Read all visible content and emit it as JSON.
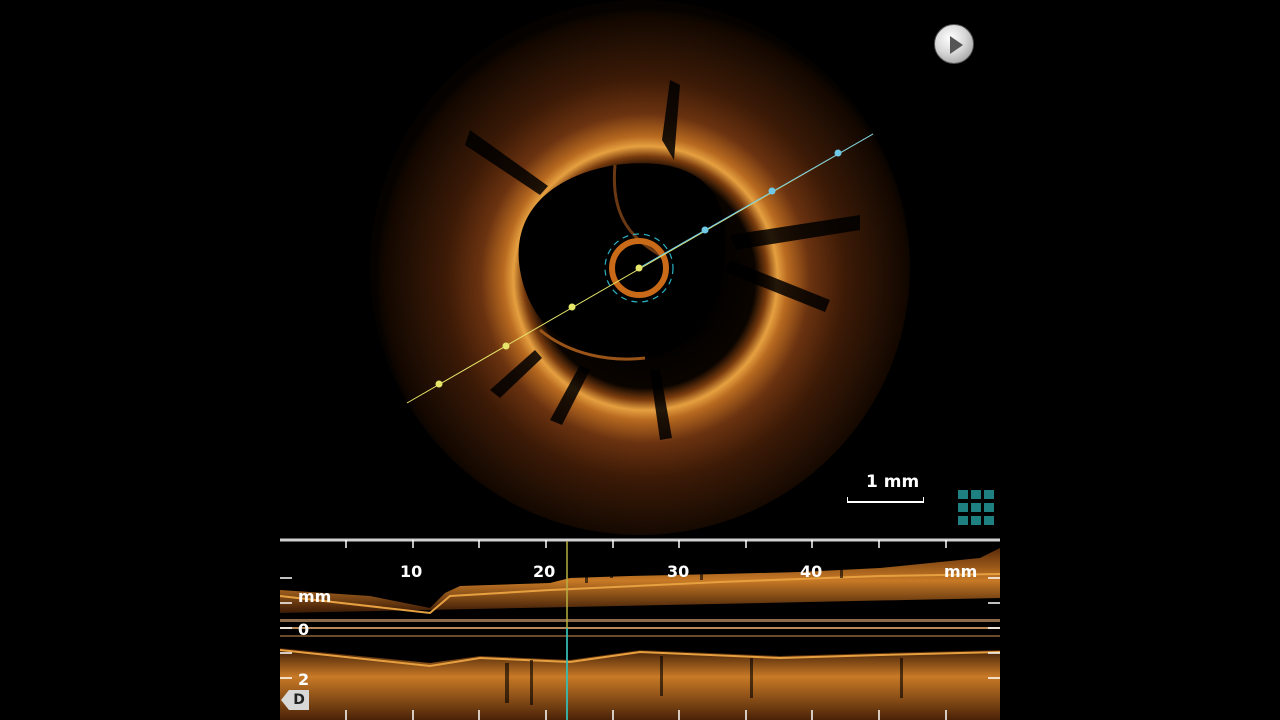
{
  "cross_section": {
    "scale_label": "1 mm"
  },
  "longitudinal": {
    "axis_unit": "mm",
    "top_ticks": [
      "10",
      "20",
      "30",
      "40"
    ],
    "depth_unit": "mm",
    "depth_ticks": [
      "0",
      "2"
    ],
    "frame_marker_position_mm": 21.5,
    "direction_badge": "D"
  },
  "controls": {
    "play_icon": "play-icon",
    "grid_icon": "layout-grid-icon"
  },
  "colors": {
    "tissue": "#e08a2a",
    "measure_proximal": "#e6e66a",
    "measure_distal": "#6ec8e6",
    "marker_line": "#1e8080",
    "grid_icon": "#1e8080"
  }
}
